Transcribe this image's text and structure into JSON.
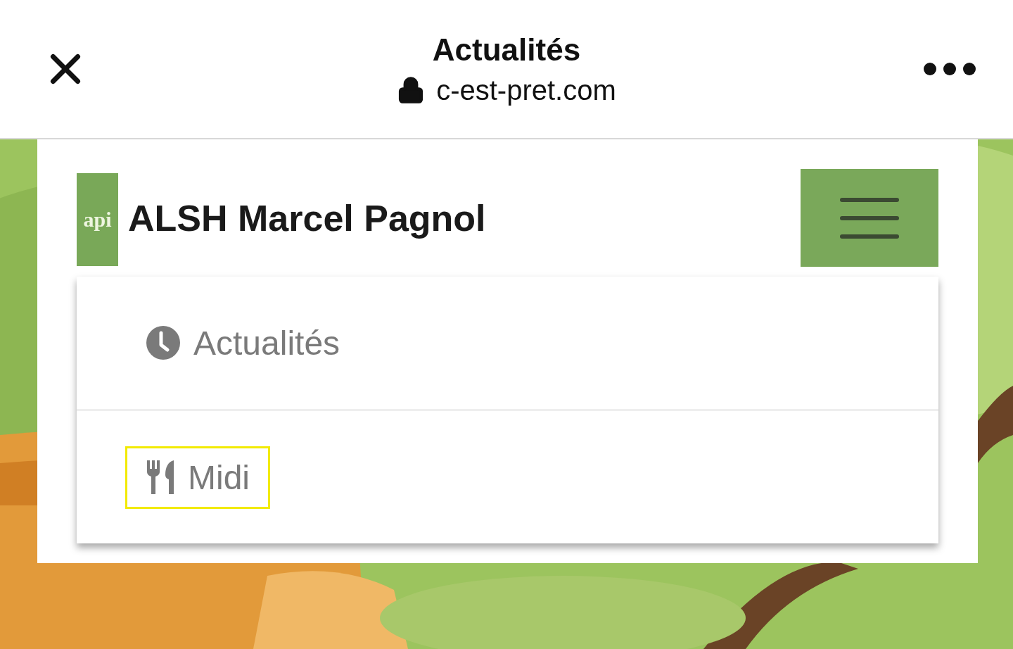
{
  "browser_bar": {
    "title": "Actualités",
    "url": "c-est-pret.com",
    "secure": true
  },
  "site_header": {
    "logo_text": "api",
    "title": "ALSH Marcel Pagnol",
    "menu_expanded": true
  },
  "menu": [
    {
      "kind": "clock",
      "label": "Actualités",
      "focused": false
    },
    {
      "kind": "cutlery",
      "label": "Midi",
      "focused": true
    }
  ]
}
